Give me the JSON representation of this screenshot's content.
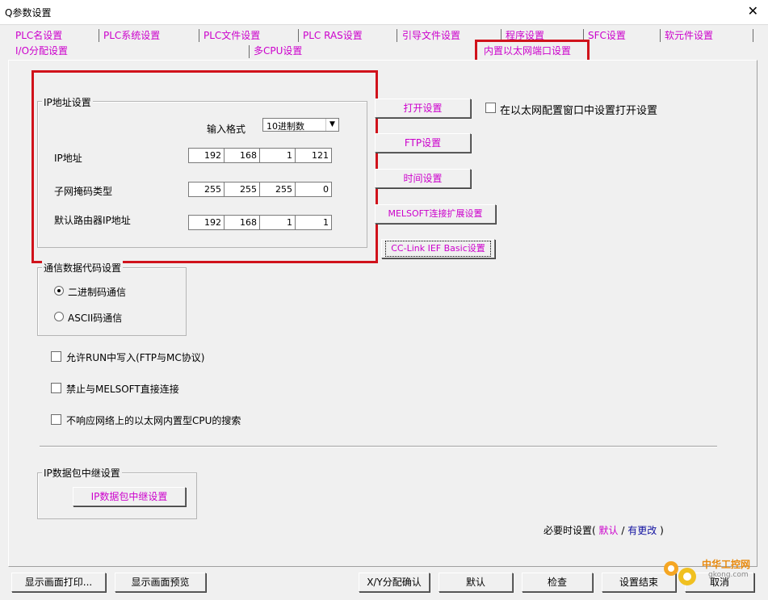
{
  "window": {
    "title": "Q参数设置",
    "close_glyph": "✕"
  },
  "tabs_row1": [
    "PLC名设置",
    "PLC系统设置",
    "PLC文件设置",
    "PLC RAS设置",
    "引导文件设置",
    "程序设置",
    "SFC设置",
    "软元件设置"
  ],
  "tabs_row2": [
    "I/O分配设置",
    "多CPU设置",
    "内置以太网端口设置"
  ],
  "ip_settings": {
    "title": "IP地址设置",
    "format_label": "输入格式",
    "format_value": "10进制数",
    "ip_label": "IP地址",
    "ip": [
      "192",
      "168",
      "1",
      "121"
    ],
    "mask_label": "子网掩码类型",
    "mask": [
      "255",
      "255",
      "255",
      "0"
    ],
    "gateway_label": "默认路由器IP地址",
    "gateway": [
      "192",
      "168",
      "1",
      "1"
    ]
  },
  "right_buttons": {
    "open": "打开设置",
    "ftp": "FTP设置",
    "time": "时间设置",
    "melsoft": "MELSOFT连接扩展设置",
    "cclink": "CC-Link IEF Basic设置",
    "open_checkbox": "在以太网配置窗口中设置打开设置"
  },
  "comm_code": {
    "title": "通信数据代码设置",
    "binary": "二进制码通信",
    "ascii": "ASCII码通信",
    "selected": "binary"
  },
  "options": {
    "allow_run_write": "允许RUN中写入(FTP与MC协议)",
    "prohibit_melsoft": "禁止与MELSOFT直接连接",
    "no_search_response": "不响应网络上的以太网内置型CPU的搜索"
  },
  "ip_relay": {
    "title": "IP数据包中继设置",
    "button": "IP数据包中继设置"
  },
  "legend": {
    "prefix": "必要时设置(",
    "default": "默认",
    "slash": "/",
    "changed": "有更改",
    "suffix": ")"
  },
  "bottom_buttons": {
    "print": "显示画面打印...",
    "preview": "显示画面预览",
    "xy_check": "X/Y分配确认",
    "default": "默认",
    "check": "检查",
    "finish": "设置结束",
    "cancel": "取消"
  },
  "watermark": {
    "text": "中华工控网",
    "url": "gkong.com"
  },
  "colors": {
    "accent_red": "#d0121b",
    "pink": "#cc00cc",
    "blue": "#1010a0"
  }
}
